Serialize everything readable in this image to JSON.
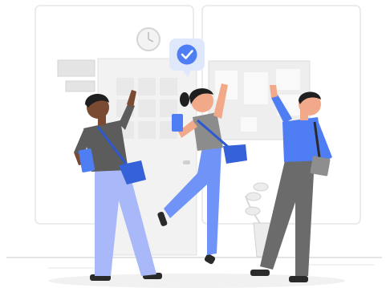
{
  "scene": {
    "accent": "#4f7df3",
    "accent_dark": "#3562d8",
    "line_color": "#e3e3e3",
    "icons": [
      "clock-icon",
      "check-badge-icon",
      "potted-plant-icon"
    ],
    "people": [
      {
        "name": "boy-left",
        "pose": "waving",
        "shirt": "#5c5c5c",
        "pants": "#a9b8f8"
      },
      {
        "name": "girl-jumping",
        "pose": "jumping",
        "shirt": "#8c8c8c",
        "pants": "#6f93f6"
      },
      {
        "name": "boy-right",
        "pose": "cheering",
        "shirt": "#4f7df3",
        "pants": "#6b6b6b"
      }
    ]
  }
}
